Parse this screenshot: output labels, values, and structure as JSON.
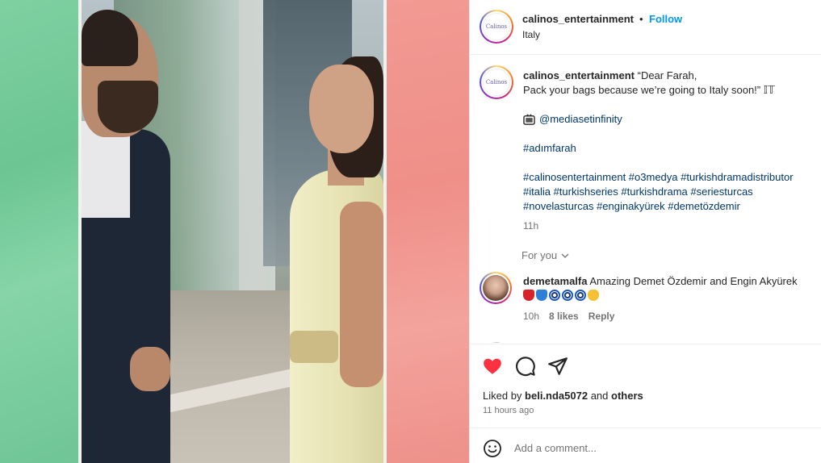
{
  "post": {
    "avatar_text": "Calinos",
    "username": "calinos_entertainment",
    "separator": "•",
    "follow_label": "Follow",
    "location": "Italy"
  },
  "caption": {
    "username": "calinos_entertainment",
    "line1": " “Dear Farah,",
    "line2": "Pack your bags because we’re going to Italy soon!” 𝕀𝕋",
    "mention": "@mediasetinfinity",
    "hashtag1": "#adımfarah",
    "tags_line1": "#calinosentertainment #o3medya #turkishdramadistributor",
    "tags_line2": "#italia #turkishseries #turkishdrama #seriesturcas",
    "tags_line3": "#novelasturcas #enginakyürek #demetözdemir",
    "time": "11h"
  },
  "for_you": "For you",
  "top_comment": {
    "username": "demetamalfa",
    "text": " Amazing Demet Özdemir and Engin Akyürek",
    "time": "10h",
    "likes": "8 likes",
    "reply_label": "Reply"
  },
  "actions": {
    "heart_color": "#ff3040",
    "liked_prefix": "Liked by ",
    "liked_user": "beli.nda5072",
    "liked_and": " and ",
    "liked_others": "others",
    "posted_ago": "11 hours ago"
  },
  "composer": {
    "placeholder": "Add a comment..."
  },
  "colors": {
    "link": "#00376b",
    "follow": "#0095f6",
    "green_band": "#6cc593",
    "red_band": "#ef8f88"
  }
}
